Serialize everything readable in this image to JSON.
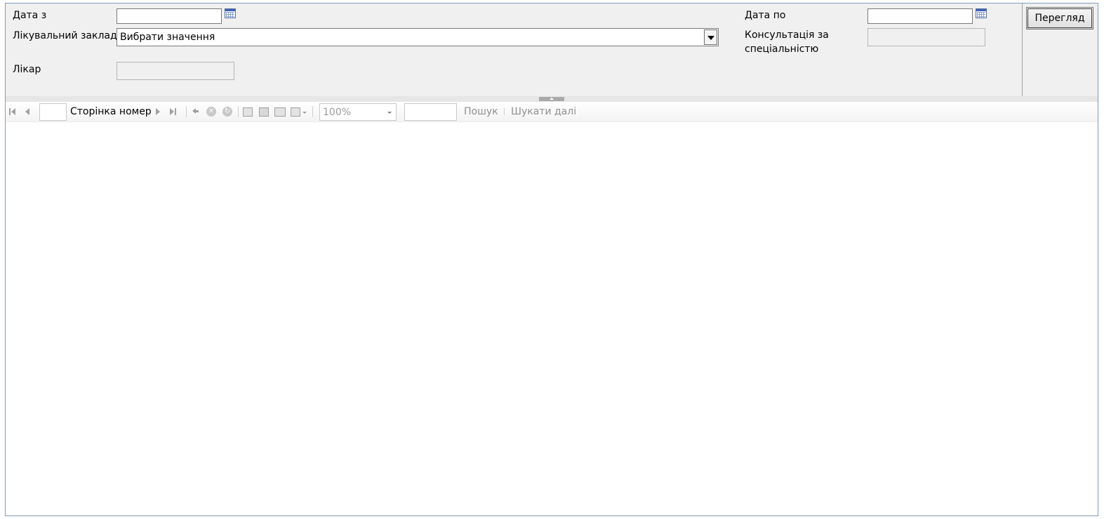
{
  "params": {
    "date_from_label": "Дата з",
    "date_from_value": "",
    "date_to_label": "Дата по",
    "date_to_value": "",
    "facility_label": "Лікувальний заклад",
    "facility_value": "Вибрати значення",
    "consult_label_line1": "Консультація за",
    "consult_label_line2": "спеціальністю",
    "consult_value": "",
    "doctor_label": "Лікар",
    "doctor_value": ""
  },
  "actions": {
    "view_label": "Перегляд"
  },
  "toolbar": {
    "page_label": "Сторінка номер",
    "page_value": "",
    "zoom_value": "100%",
    "find_value": "",
    "find_label": "Пошук",
    "find_next_label": "Шукати далі"
  },
  "icons": {
    "calendar": "calendar-icon",
    "first_page": "first-page-icon",
    "prev_page": "previous-page-icon",
    "next_page": "next-page-icon",
    "last_page": "last-page-icon",
    "back": "back-icon",
    "stop": "stop-icon",
    "refresh": "refresh-icon",
    "print": "print-icon",
    "print_layout": "print-layout-icon",
    "page_setup": "page-setup-icon",
    "export": "export-icon"
  }
}
